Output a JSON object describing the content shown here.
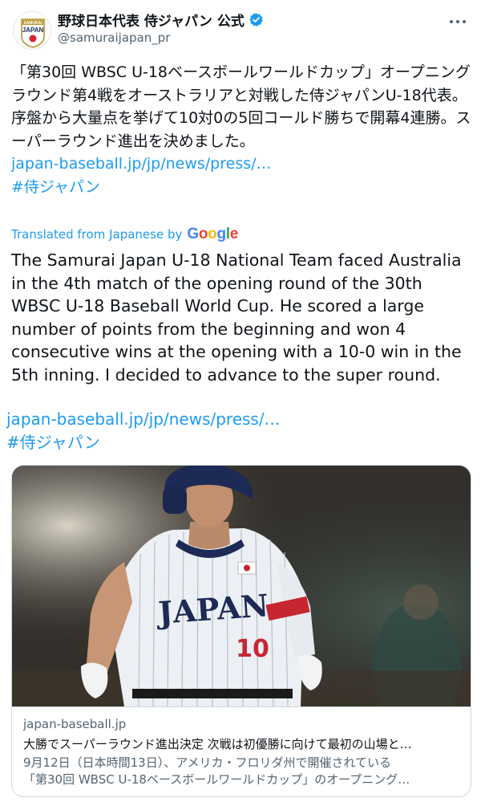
{
  "author": {
    "display_name": "野球日本代表 侍ジャパン 公式",
    "handle": "@samuraijapan_pr",
    "avatar_text_top": "SAMURAI",
    "avatar_text_bottom": "JAPAN"
  },
  "tweet": {
    "text_jp": "「第30回 WBSC U-18ベースボールワールドカップ」オープニングラウンド第4戦をオーストラリアと対戦した侍ジャパンU-18代表。序盤から大量点を挙げて10対0の5回コールド勝ちで開幕4連勝。スーパーラウンド進出を決めました。",
    "link_jp": "japan-baseball.jp/jp/news/press/…",
    "hashtag_jp": "#侍ジャパン",
    "translated_label": "Translated from Japanese by",
    "google_letters": [
      "G",
      "o",
      "o",
      "g",
      "l",
      "e"
    ],
    "text_en": "The Samurai Japan U-18 National Team faced Australia in the 4th match of the opening round of the 30th WBSC U-18 Baseball World Cup. He scored a large number of points from the beginning and won 4 consecutive wins at the opening with a 10-0 win in the 5th inning. I decided to advance to the super round.",
    "link_en": "japan-baseball.jp/jp/news/press/…",
    "hashtag_en": "#侍ジャパン"
  },
  "card": {
    "jersey_text": "JAPAN",
    "jersey_number": "10",
    "domain": "japan-baseball.jp",
    "title": "大勝でスーパーラウンド進出決定 次戦は初優勝に向けて最初の山場と…",
    "description_line1": "9月12日（日本時間13日）、アメリカ・フロリダ州で開催されている",
    "description_line2": "「第30回 WBSC U-18ベースボールワールドカップ」のオープニング…"
  },
  "colors": {
    "link": "#1d9bf0",
    "verified": "#1d9bf0",
    "text": "#0f1419",
    "secondary": "#536471"
  },
  "icons": [
    "verified-badge-icon",
    "more-options-icon"
  ]
}
